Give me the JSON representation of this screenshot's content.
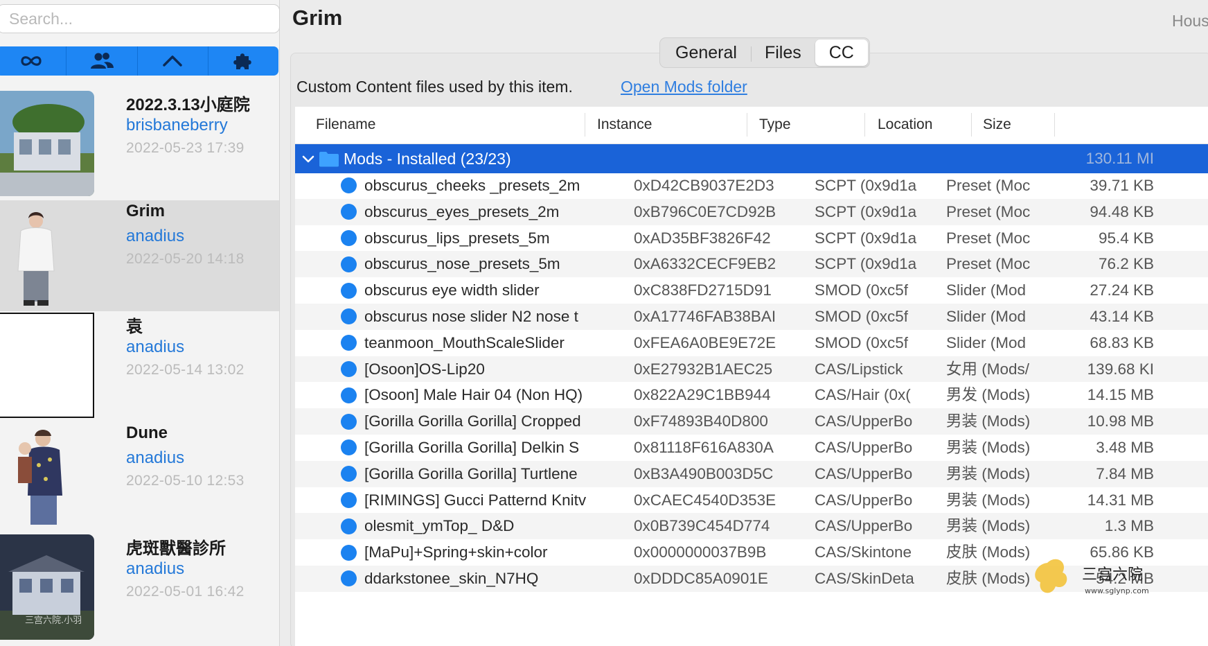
{
  "search": {
    "placeholder": "Search..."
  },
  "filters": [
    {
      "icon": "infinity-icon"
    },
    {
      "icon": "people-icon"
    },
    {
      "icon": "house-icon"
    },
    {
      "icon": "puzzle-icon"
    }
  ],
  "items": [
    {
      "title": "2022.3.13小庭院",
      "author": "brisbaneberry",
      "date": "2022-05-23 17:39",
      "thumb": "house-photo"
    },
    {
      "title": "Grim",
      "author": "anadius",
      "date": "2022-05-20 14:18",
      "thumb": "sim-portrait",
      "selected": true
    },
    {
      "title": "袁",
      "author": "anadius",
      "date": "2022-05-14 13:02",
      "thumb": "blank"
    },
    {
      "title": "Dune",
      "author": "anadius",
      "date": "2022-05-10 12:53",
      "thumb": "sim-family"
    },
    {
      "title": "虎斑獸醫診所",
      "author": "anadius",
      "date": "2022-05-01 16:42",
      "thumb": "building-photo",
      "thumb_text": "三宫六院.小羽"
    }
  ],
  "main": {
    "title": "Grim",
    "right_label": "Hous",
    "tabs": [
      "General",
      "Files",
      "CC"
    ],
    "active_tab": "CC",
    "description": "Custom Content files used by this item.",
    "link": "Open Mods folder"
  },
  "table": {
    "columns": [
      "Filename",
      "Instance",
      "Type",
      "Location",
      "Size"
    ],
    "group": {
      "label": "Mods - Installed (23/23)",
      "size": "130.11 MI"
    },
    "rows": [
      {
        "name": "obscurus_cheeks _presets_2m",
        "instance": "0xD42CB9037E2D3",
        "type": "SCPT (0x9d1a",
        "location": "Preset (Moc",
        "size": "39.71 KB"
      },
      {
        "name": "obscurus_eyes_presets_2m",
        "instance": "0xB796C0E7CD92B",
        "type": "SCPT (0x9d1a",
        "location": "Preset (Moc",
        "size": "94.48 KB"
      },
      {
        "name": "obscurus_lips_presets_5m",
        "instance": "0xAD35BF3826F42",
        "type": "SCPT (0x9d1a",
        "location": "Preset (Moc",
        "size": "95.4 KB"
      },
      {
        "name": "obscurus_nose_presets_5m",
        "instance": "0xA6332CECF9EB2",
        "type": "SCPT (0x9d1a",
        "location": "Preset (Moc",
        "size": "76.2 KB"
      },
      {
        "name": "obscurus eye width slider",
        "instance": "0xC838FD2715D91",
        "type": "SMOD (0xc5f",
        "location": "Slider (Mod",
        "size": "27.24 KB"
      },
      {
        "name": "obscurus nose slider N2 nose t",
        "instance": "0xA17746FAB38BAI",
        "type": "SMOD (0xc5f",
        "location": "Slider (Mod",
        "size": "43.14 KB"
      },
      {
        "name": "teanmoon_MouthScaleSlider",
        "instance": "0xFEA6A0BE9E72E",
        "type": "SMOD (0xc5f",
        "location": "Slider (Mod",
        "size": "68.83 KB"
      },
      {
        "name": "[Osoon]OS-Lip20",
        "instance": "0xE27932B1AEC25",
        "type": "CAS/Lipstick",
        "location": "女用 (Mods/",
        "size": "139.68 KI"
      },
      {
        "name": "[Osoon] Male Hair 04 (Non HQ)",
        "instance": "0x822A29C1BB944",
        "type": "CAS/Hair (0x(",
        "location": "男发 (Mods)",
        "size": "14.15 MB"
      },
      {
        "name": "[Gorilla Gorilla Gorilla] Cropped",
        "instance": "0xF74893B40D800",
        "type": "CAS/UpperBo",
        "location": "男装 (Mods)",
        "size": "10.98 MB"
      },
      {
        "name": "[Gorilla Gorilla Gorilla] Delkin S",
        "instance": "0x81118F616A830A",
        "type": "CAS/UpperBo",
        "location": "男装 (Mods)",
        "size": "3.48 MB"
      },
      {
        "name": "[Gorilla Gorilla Gorilla] Turtlene",
        "instance": "0xB3A490B003D5C",
        "type": "CAS/UpperBo",
        "location": "男装 (Mods)",
        "size": "7.84 MB"
      },
      {
        "name": "[RIMINGS] Gucci Patternd Knitv",
        "instance": "0xCAEC4540D353E",
        "type": "CAS/UpperBo",
        "location": "男装 (Mods)",
        "size": "14.31 MB"
      },
      {
        "name": "olesmit_ymTop_ D&D",
        "instance": "0x0B739C454D774",
        "type": "CAS/UpperBo",
        "location": "男装 (Mods)",
        "size": "1.3 MB"
      },
      {
        "name": "[MaPu]+Spring+skin+color",
        "instance": "0x0000000037B9B",
        "type": "CAS/Skintone",
        "location": "皮肤 (Mods)",
        "size": "65.86 KB"
      },
      {
        "name": "ddarkstonee_skin_N7HQ",
        "instance": "0xDDDC85A0901E",
        "type": "CAS/SkinDeta",
        "location": "皮肤 (Mods)",
        "size": "54.2 MB"
      }
    ]
  },
  "watermark": {
    "text": "三宫六院",
    "url": "www.sglynp.com"
  },
  "colors": {
    "accent": "#1e86f4",
    "selection": "#1a63d8",
    "link": "#2f7ee0",
    "dot": "#1b82f0"
  }
}
